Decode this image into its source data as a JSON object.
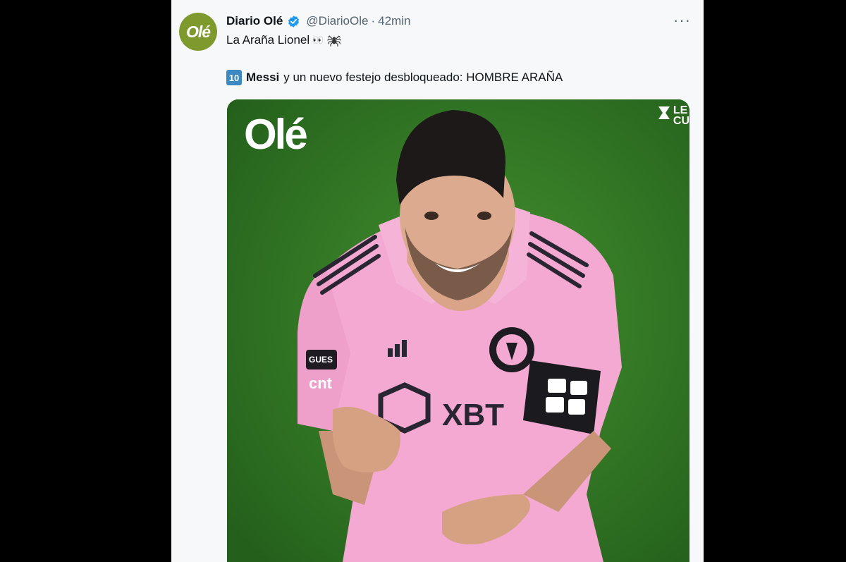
{
  "tweet": {
    "avatar_text": "Olé",
    "display_name": "Diario Olé",
    "handle": "@DiarioOle",
    "separator": "·",
    "time": "42min",
    "more_label": "···",
    "line1": "La Araña Lionel",
    "line1_emoji_eyes": "👀",
    "line1_emoji_spider": "spider-emoji",
    "line2_keycap": "10",
    "line2_bold": "Messi",
    "line2_rest": "y un nuevo festejo desbloqueado: HOMBRE ARAÑA"
  },
  "media": {
    "watermark": "Olé",
    "corner_logo_text_top": "LE",
    "corner_logo_text_bottom": "CU",
    "jersey_text": "XBT",
    "sleeve_text": "cnt",
    "badge_text": "GUES"
  },
  "colors": {
    "page_bg": "#000000",
    "card_bg": "#f7f8f9",
    "verified": "#1d9bf0",
    "avatar": "#7f9a2c",
    "pitch": "#327a25",
    "jersey": "#f3a9d1"
  },
  "icons": [
    "verified-badge-icon",
    "more-icon",
    "spider-emoji-icon",
    "keycap-ten-icon",
    "hourglass-logo-icon"
  ]
}
